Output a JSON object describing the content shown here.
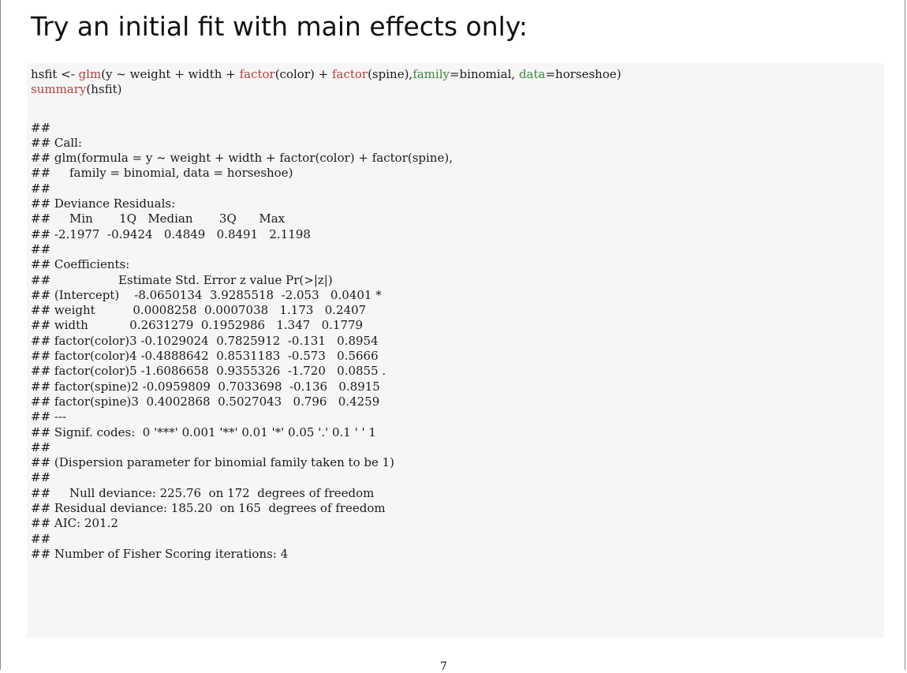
{
  "slide": {
    "title": "Try an initial fit with main effects only:",
    "page_number": "7"
  },
  "code": {
    "line1": {
      "a": "hsfit <- ",
      "glm": "glm",
      "b": "(y ~ weight + width + ",
      "factor1": "factor",
      "c": "(color) + ",
      "factor2": "factor",
      "d": "(spine),",
      "family_kw": "family",
      "e": "=binomial, ",
      "data_kw": "data",
      "f": "=horseshoe)"
    },
    "line2": {
      "summary": "summary",
      "a": "(hsfit)"
    }
  },
  "output": [
    "##",
    "## Call:",
    "## glm(formula = y ~ weight + width + factor(color) + factor(spine),",
    "##     family = binomial, data = horseshoe)",
    "##",
    "## Deviance Residuals:",
    "##     Min       1Q   Median       3Q      Max",
    "## -2.1977  -0.9424   0.4849   0.8491   2.1198",
    "##",
    "## Coefficients:",
    "##                  Estimate Std. Error z value Pr(>|z|)",
    "## (Intercept)    -8.0650134  3.9285518  -2.053   0.0401 *",
    "## weight          0.0008258  0.0007038   1.173   0.2407",
    "## width           0.2631279  0.1952986   1.347   0.1779",
    "## factor(color)3 -0.1029024  0.7825912  -0.131   0.8954",
    "## factor(color)4 -0.4888642  0.8531183  -0.573   0.5666",
    "## factor(color)5 -1.6086658  0.9355326  -1.720   0.0855 .",
    "## factor(spine)2 -0.0959809  0.7033698  -0.136   0.8915",
    "## factor(spine)3  0.4002868  0.5027043   0.796   0.4259",
    "## ---",
    "## Signif. codes:  0 '***' 0.001 '**' 0.01 '*' 0.05 '.' 0.1 ' ' 1",
    "##",
    "## (Dispersion parameter for binomial family taken to be 1)",
    "##",
    "##     Null deviance: 225.76  on 172  degrees of freedom",
    "## Residual deviance: 185.20  on 165  degrees of freedom",
    "## AIC: 201.2",
    "##",
    "## Number of Fisher Scoring iterations: 4"
  ],
  "colors": {
    "function_name": "#b0433a",
    "argument_keyword": "#3c8a3c",
    "code_background": "#f6f6f6"
  }
}
